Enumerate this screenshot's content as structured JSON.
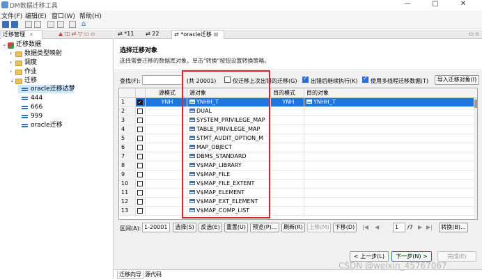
{
  "window": {
    "title": "DM数据迁移工具",
    "controls": [
      "—",
      "□",
      "✕"
    ]
  },
  "menu": [
    "文件(F)",
    "编辑(E)",
    "窗口(W)",
    "帮助(H)"
  ],
  "left_panel": {
    "tab_label": "迁移管理",
    "tree": [
      {
        "label": "迁移数据",
        "level": 0,
        "type": "root",
        "expanded": true
      },
      {
        "label": "数据类型映射",
        "level": 1,
        "type": "folder",
        "expanded": false
      },
      {
        "label": "调度",
        "level": 1,
        "type": "folder",
        "expanded": false
      },
      {
        "label": "作业",
        "level": 1,
        "type": "folder",
        "expanded": false
      },
      {
        "label": "迁移",
        "level": 1,
        "type": "folder",
        "expanded": true
      },
      {
        "label": "oracle迁移达梦",
        "level": 2,
        "type": "migration",
        "selected": true
      },
      {
        "label": "444",
        "level": 2,
        "type": "migration"
      },
      {
        "label": "666",
        "level": 2,
        "type": "migration"
      },
      {
        "label": "999",
        "level": 2,
        "type": "migration"
      },
      {
        "label": "oracle迁移",
        "level": 2,
        "type": "migration"
      }
    ]
  },
  "editor_tabs": [
    {
      "label": "*11",
      "active": false
    },
    {
      "label": "22",
      "active": false
    },
    {
      "label": "*oracle迁移",
      "active": true
    }
  ],
  "wizard": {
    "title": "选择迁移对象",
    "description": "选择需要迁移的数据库对象，单击\"转换\"按钮设置转换策略。",
    "find_label": "查找(F):",
    "find_value": "",
    "count_label": "(共 20001)",
    "opt_only_error": {
      "label": "仅迁移上次出错的迁移(G)",
      "checked": false
    },
    "opt_continue": {
      "label": "出错后继续执行(K)",
      "checked": true
    },
    "opt_multithread": {
      "label": "使用多线程迁移数据(T)",
      "checked": true
    },
    "import_button": "导入迁移对象(I)",
    "columns": [
      "源模式",
      "源对象",
      "目的模式",
      "目的对象"
    ],
    "rows": [
      {
        "num": "1",
        "checked": true,
        "src_schema": "YNH",
        "src_object": "YNHH_T",
        "dst_schema": "YNH",
        "dst_object": "YNHH_T",
        "selected": true
      },
      {
        "num": "2",
        "checked": false,
        "src_schema": "",
        "src_object": "DUAL",
        "dst_schema": "",
        "dst_object": ""
      },
      {
        "num": "3",
        "checked": false,
        "src_schema": "",
        "src_object": "SYSTEM_PRIVILEGE_MAP",
        "dst_schema": "",
        "dst_object": ""
      },
      {
        "num": "4",
        "checked": false,
        "src_schema": "",
        "src_object": "TABLE_PRIVILEGE_MAP",
        "dst_schema": "",
        "dst_object": ""
      },
      {
        "num": "5",
        "checked": false,
        "src_schema": "",
        "src_object": "STMT_AUDIT_OPTION_M",
        "dst_schema": "",
        "dst_object": ""
      },
      {
        "num": "6",
        "checked": false,
        "src_schema": "",
        "src_object": "MAP_OBJECT",
        "dst_schema": "",
        "dst_object": ""
      },
      {
        "num": "7",
        "checked": false,
        "src_schema": "",
        "src_object": "DBMS_STANDARD",
        "dst_schema": "",
        "dst_object": ""
      },
      {
        "num": "8",
        "checked": false,
        "src_schema": "",
        "src_object": "V$MAP_LIBRARY",
        "dst_schema": "",
        "dst_object": ""
      },
      {
        "num": "9",
        "checked": false,
        "src_schema": "",
        "src_object": "V$MAP_FILE",
        "dst_schema": "",
        "dst_object": ""
      },
      {
        "num": "10",
        "checked": false,
        "src_schema": "",
        "src_object": "V$MAP_FILE_EXTENT",
        "dst_schema": "",
        "dst_object": ""
      },
      {
        "num": "11",
        "checked": false,
        "src_schema": "",
        "src_object": "V$MAP_ELEMENT",
        "dst_schema": "",
        "dst_object": ""
      },
      {
        "num": "12",
        "checked": false,
        "src_schema": "",
        "src_object": "V$MAP_EXT_ELEMENT",
        "dst_schema": "",
        "dst_object": ""
      },
      {
        "num": "13",
        "checked": false,
        "src_schema": "",
        "src_object": "V$MAP_COMP_LIST",
        "dst_schema": "",
        "dst_object": ""
      }
    ],
    "range_label": "区间(A):",
    "range_value": "1-20001",
    "range_buttons": [
      "选择(S)",
      "反选(E)",
      "重置(U)",
      "预览(P)...",
      "刷新(R)",
      "上移(M)",
      "下移(D)"
    ],
    "page_value": "1",
    "page_total": "/7",
    "convert_button": "转换(B)...",
    "prev_button": "< 上一步(L)",
    "next_button": "下一步(N) >",
    "finish_button": "完成(E)"
  },
  "bottom_tabs": [
    "迁移向导",
    "源代码"
  ],
  "watermark": "CSDN @weixin_45767067",
  "colors": {
    "selection": "#1f74e0",
    "highlight_box": "#e0232f",
    "check_accent": "#2a6fd6"
  }
}
